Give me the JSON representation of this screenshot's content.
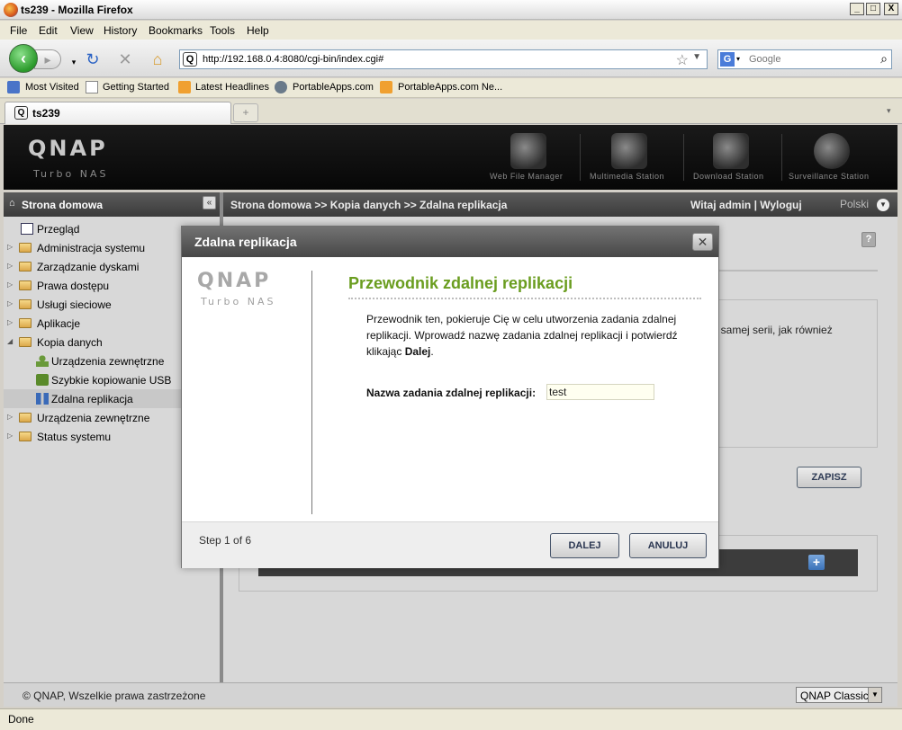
{
  "window": {
    "title": "ts239 - Mozilla Firefox",
    "controls": {
      "minimize": "_",
      "maximize": "□",
      "close": "X"
    }
  },
  "menu": [
    "File",
    "Edit",
    "View",
    "History",
    "Bookmarks",
    "Tools",
    "Help"
  ],
  "navigation": {
    "url": "http://192.168.0.4:8080/cgi-bin/index.cgi#",
    "search_placeholder": "Google"
  },
  "bookmarks": [
    "Most Visited",
    "Getting Started",
    "Latest Headlines",
    "PortableApps.com",
    "PortableApps.com Ne..."
  ],
  "tabs": [
    {
      "label": "ts239"
    }
  ],
  "qnap": {
    "logo": "QNAP",
    "subtitle": "Turbo NAS",
    "apps": [
      "Web File Manager",
      "Multimedia Station",
      "Download Station",
      "Surveillance Station"
    ]
  },
  "header_nav": {
    "sidebar_title": "Strona domowa",
    "breadcrumb": "Strona domowa >> Kopia danych >> Zdalna replikacja",
    "welcome": "Witaj admin | Wyloguj",
    "language": "Polski"
  },
  "sidebar": {
    "items": [
      {
        "label": "Przegląd",
        "level": 0,
        "expand": "",
        "icon": "overview-icon"
      },
      {
        "label": "Administracja systemu",
        "level": 0,
        "expand": "▷",
        "icon": "folder-icon"
      },
      {
        "label": "Zarządzanie dyskami",
        "level": 0,
        "expand": "▷",
        "icon": "folder-icon"
      },
      {
        "label": "Prawa dostępu",
        "level": 0,
        "expand": "▷",
        "icon": "folder-icon"
      },
      {
        "label": "Usługi sieciowe",
        "level": 0,
        "expand": "▷",
        "icon": "folder-icon"
      },
      {
        "label": "Aplikacje",
        "level": 0,
        "expand": "▷",
        "icon": "folder-icon"
      },
      {
        "label": "Kopia danych",
        "level": 0,
        "expand": "◢",
        "icon": "folder-open-icon"
      },
      {
        "label": "Urządzenia zewnętrzne",
        "level": 1,
        "expand": "",
        "icon": "usb-device-icon"
      },
      {
        "label": "Szybkie kopiowanie USB",
        "level": 1,
        "expand": "",
        "icon": "usb-copy-icon"
      },
      {
        "label": "Zdalna replikacja",
        "level": 1,
        "expand": "",
        "icon": "replication-icon",
        "selected": true
      },
      {
        "label": "Urządzenia zewnętrzne",
        "level": 0,
        "expand": "▷",
        "icon": "folder-icon"
      },
      {
        "label": "Status systemu",
        "level": 0,
        "expand": "▷",
        "icon": "folder-icon"
      }
    ]
  },
  "background": {
    "fragment": "ej samej serii, jak również",
    "save_button": "ZAPISZ",
    "help": "?",
    "add": "+"
  },
  "dialog": {
    "title": "Zdalna replikacja",
    "close": "✕",
    "logo": "QNAP",
    "logo_sub": "Turbo NAS",
    "heading": "Przewodnik zdalnej replikacji",
    "description": "Przewodnik ten, pokieruje Cię w celu utworzenia zadania zdalnej replikacji.  Wprowadź nazwę zadania zdalnej replikacji i potwierdź klikając ",
    "description_bold": "Dalej",
    "description_end": ".",
    "field_label": "Nazwa zadania zdalnej replikacji:",
    "field_value": "test",
    "step": "Step 1 of 6",
    "next_button": "DALEJ",
    "cancel_button": "ANULUJ"
  },
  "footer": {
    "copyright": "© QNAP, Wszelkie prawa zastrzeżone",
    "theme": "QNAP Classic"
  },
  "status": {
    "text": "Done"
  },
  "colors": {
    "heading_green": "#6a9d1f",
    "header_dark": "#0a0a0a",
    "button_border": "#46546a"
  }
}
